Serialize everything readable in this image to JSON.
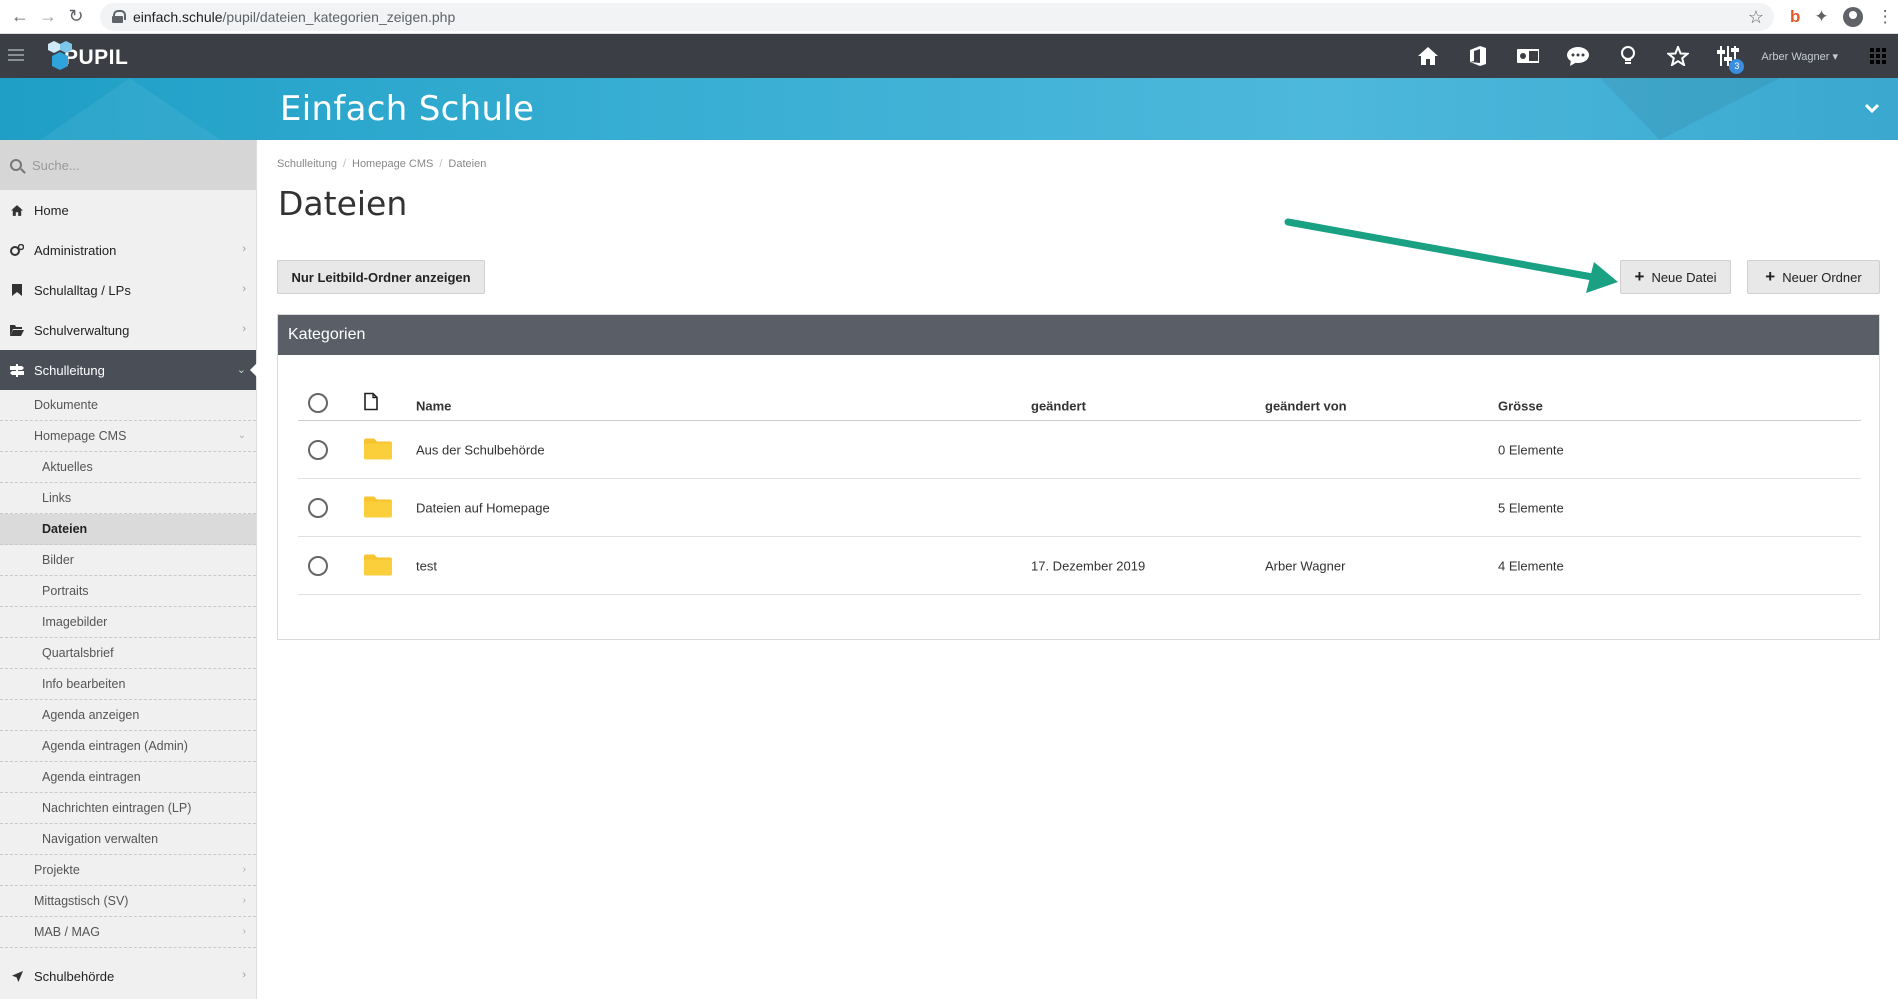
{
  "browser": {
    "url_host": "einfach.schule",
    "url_path": "/pupil/dateien_kategorien_zeigen.php"
  },
  "app": {
    "logo_text": "PUPIL",
    "user_name": "Arber Wagner",
    "tools_badge": "3",
    "banner_title": "Einfach Schule"
  },
  "sidebar": {
    "search_placeholder": "Suche...",
    "items": [
      {
        "label": "Home",
        "icon": "home-icon"
      },
      {
        "label": "Administration",
        "icon": "cogs-icon"
      },
      {
        "label": "Schulalltag / LPs",
        "icon": "bookmark-icon"
      },
      {
        "label": "Schulverwaltung",
        "icon": "folder-open-icon"
      },
      {
        "label": "Schulleitung",
        "icon": "signpost-icon"
      }
    ],
    "sub_items": [
      {
        "label": "Dokumente"
      },
      {
        "label": "Homepage CMS"
      },
      {
        "label": "Aktuelles"
      },
      {
        "label": "Links"
      },
      {
        "label": "Dateien"
      },
      {
        "label": "Bilder"
      },
      {
        "label": "Portraits"
      },
      {
        "label": "Imagebilder"
      },
      {
        "label": "Quartalsbrief"
      },
      {
        "label": "Info bearbeiten"
      },
      {
        "label": "Agenda anzeigen"
      },
      {
        "label": "Agenda eintragen (Admin)"
      },
      {
        "label": "Agenda eintragen"
      },
      {
        "label": "Nachrichten eintragen (LP)"
      },
      {
        "label": "Navigation verwalten"
      },
      {
        "label": "Projekte"
      },
      {
        "label": "Mittagstisch (SV)"
      },
      {
        "label": "MAB / MAG"
      }
    ],
    "bottom_item": {
      "label": "Schulbehörde",
      "icon": "location-arrow-icon"
    }
  },
  "main": {
    "breadcrumb": [
      "Schulleitung",
      "Homepage CMS",
      "Dateien"
    ],
    "title": "Dateien",
    "btn_leitbild": "Nur Leitbild-Ordner anzeigen",
    "btn_neue_datei": "Neue Datei",
    "btn_neuer_ordner": "Neuer Ordner",
    "panel_title": "Kategorien",
    "columns": {
      "name": "Name",
      "changed": "geändert",
      "changed_by": "geändert von",
      "size": "Grösse"
    },
    "rows": [
      {
        "name": "Aus der Schulbehörde",
        "changed": "",
        "changed_by": "",
        "size": "0 Elemente"
      },
      {
        "name": "Dateien auf Homepage",
        "changed": "",
        "changed_by": "",
        "size": "5 Elemente"
      },
      {
        "name": "test",
        "changed": "17. Dezember 2019",
        "changed_by": "Arber Wagner",
        "size": "4 Elemente"
      }
    ]
  },
  "colors": {
    "app_bar": "#3b3f45",
    "banner": "#38aed3",
    "panel_header": "#5a5f67",
    "folder": "#f7c32e",
    "annotation_arrow": "#1aa083",
    "badge": "#3b8de0"
  }
}
